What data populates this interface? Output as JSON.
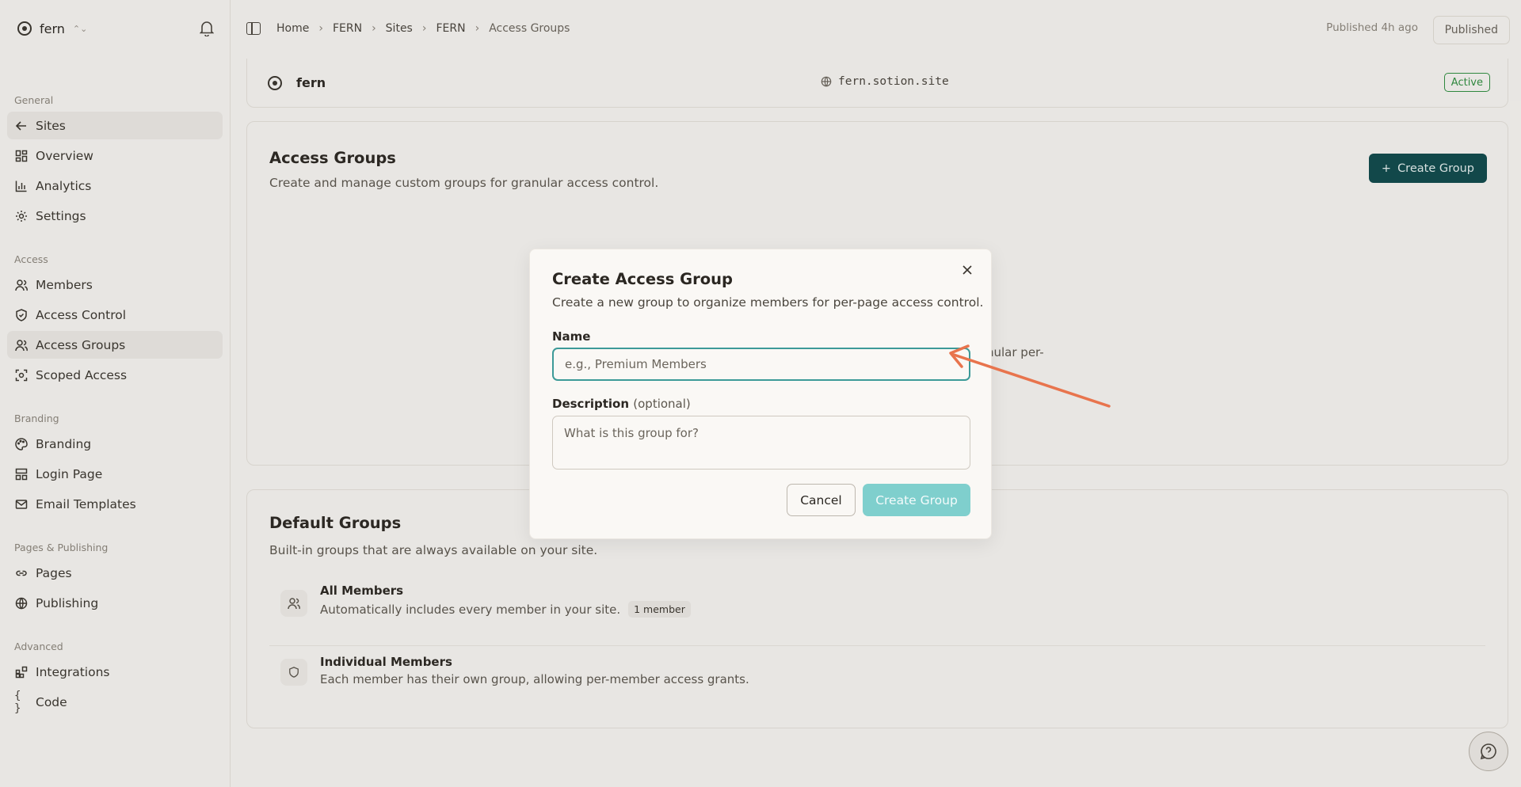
{
  "workspace": {
    "name": "fern"
  },
  "sidebar": {
    "sections": [
      {
        "title": "General",
        "items": [
          {
            "label": "Sites",
            "icon": "arrow-left-icon",
            "active": false
          },
          {
            "label": "Overview",
            "icon": "grid-icon"
          },
          {
            "label": "Analytics",
            "icon": "bar-chart-icon"
          },
          {
            "label": "Settings",
            "icon": "gear-icon"
          }
        ]
      },
      {
        "title": "Access",
        "items": [
          {
            "label": "Members",
            "icon": "user-icon"
          },
          {
            "label": "Access Control",
            "icon": "shield-icon"
          },
          {
            "label": "Access Groups",
            "icon": "users-icon",
            "active": true
          },
          {
            "label": "Scoped Access",
            "icon": "scope-icon"
          }
        ]
      },
      {
        "title": "Branding",
        "items": [
          {
            "label": "Branding",
            "icon": "palette-icon"
          },
          {
            "label": "Login Page",
            "icon": "layout-icon"
          },
          {
            "label": "Email Templates",
            "icon": "mail-icon"
          }
        ]
      },
      {
        "title": "Pages & Publishing",
        "items": [
          {
            "label": "Pages",
            "icon": "link-icon"
          },
          {
            "label": "Publishing",
            "icon": "globe-icon"
          }
        ]
      },
      {
        "title": "Advanced",
        "items": [
          {
            "label": "Integrations",
            "icon": "puzzle-icon"
          },
          {
            "label": "Code",
            "icon": "braces-icon"
          }
        ]
      }
    ]
  },
  "breadcrumb": [
    "Home",
    "FERN",
    "Sites",
    "FERN",
    "Access Groups"
  ],
  "publish": {
    "status": "Published 4h ago",
    "button": "Published"
  },
  "site": {
    "name": "fern",
    "domain": "fern.sotion.site",
    "status": "Active"
  },
  "access_groups": {
    "title": "Access Groups",
    "subtitle": "Create and manage custom groups for granular access control.",
    "create_button": "Create Group",
    "partial_text": "nular per-"
  },
  "default_groups": {
    "title": "Default Groups",
    "subtitle": "Built-in groups that are always available on your site.",
    "rows": [
      {
        "name": "All Members",
        "description": "Automatically includes every member in your site.",
        "badge": "1 member"
      },
      {
        "name": "Individual Members",
        "description": "Each member has their own group, allowing per-member access grants.",
        "badge": ""
      }
    ]
  },
  "modal": {
    "title": "Create Access Group",
    "subtitle": "Create a new group to organize members for per-page access control.",
    "name_label": "Name",
    "name_placeholder": "e.g., Premium Members",
    "name_value": "",
    "description_label": "Description",
    "description_optional": "(optional)",
    "description_placeholder": "What is this group for?",
    "cancel": "Cancel",
    "create": "Create Group"
  },
  "colors": {
    "accent": "#0f4a4c",
    "accent_light": "#7fcfcd",
    "focus_ring": "#3c9a98",
    "annotation_arrow": "#e8744d",
    "active_badge": "#2f8f3f"
  }
}
